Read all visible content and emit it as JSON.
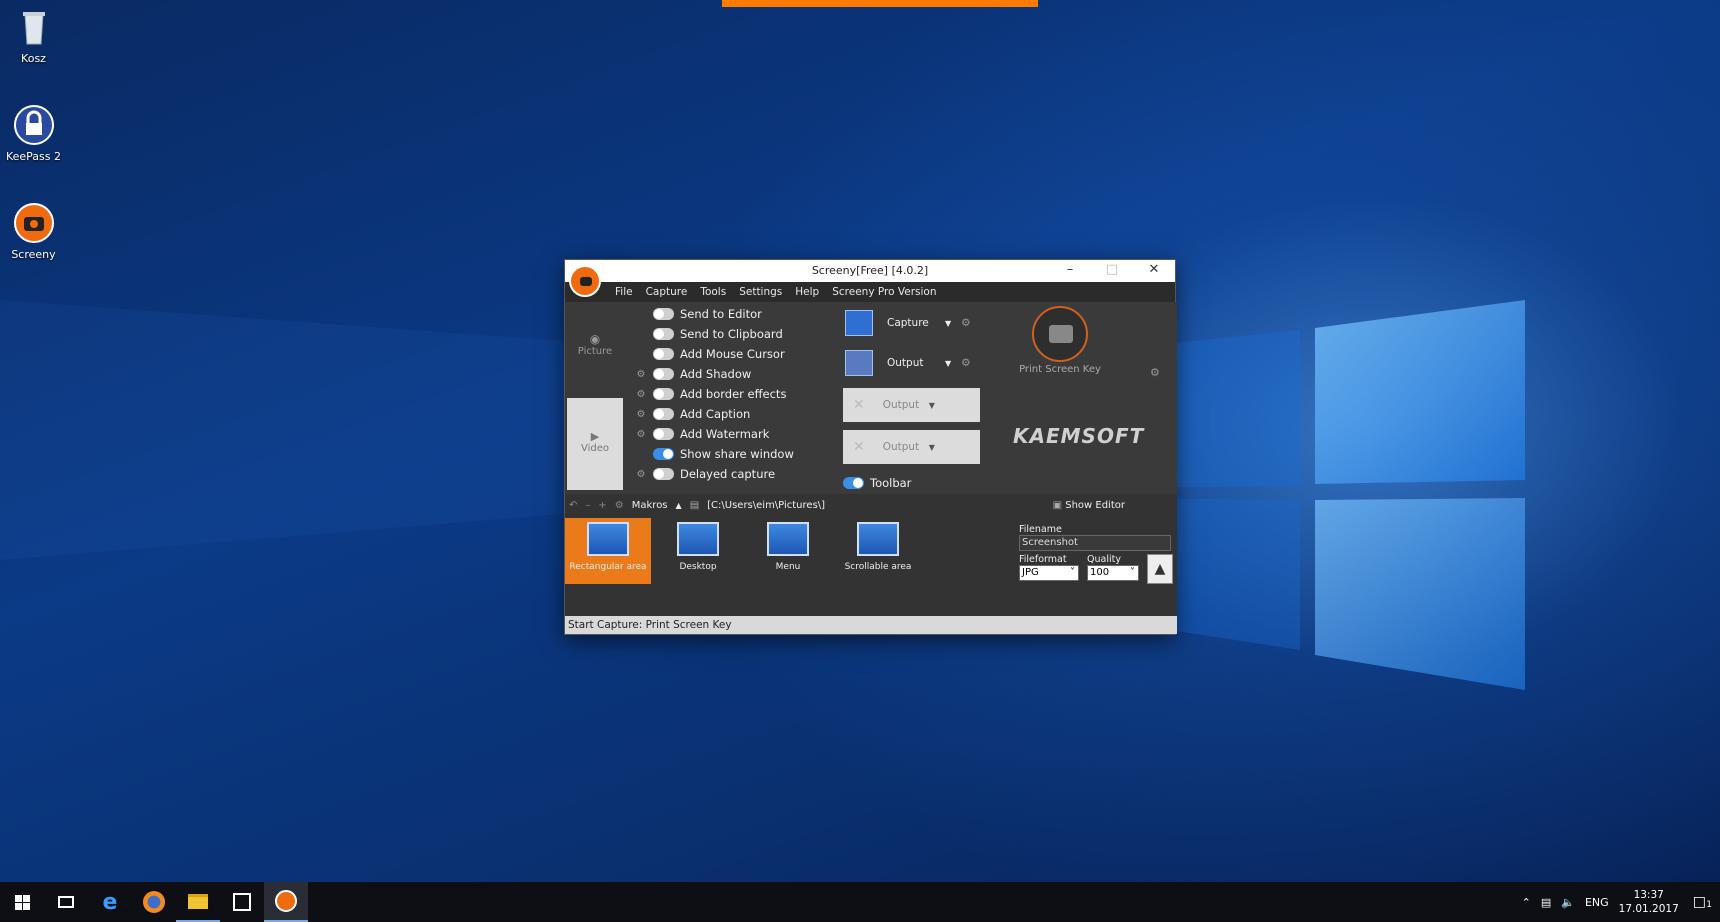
{
  "desktop": {
    "icons": [
      {
        "label": "Kosz"
      },
      {
        "label": "KeePass 2"
      },
      {
        "label": "Screeny"
      }
    ]
  },
  "window": {
    "title": "Screeny[Free] [4.0.2]",
    "menu": [
      "File",
      "Capture",
      "Tools",
      "Settings",
      "Help",
      "Screeny Pro Version"
    ],
    "sidetabs": [
      "Picture",
      "Video"
    ],
    "options": [
      {
        "label": "Send to Editor",
        "on": false
      },
      {
        "label": "Send to Clipboard",
        "on": false
      },
      {
        "label": "Add Mouse Cursor",
        "on": false
      },
      {
        "label": "Add Shadow",
        "on": false
      },
      {
        "label": "Add border effects",
        "on": false
      },
      {
        "label": "Add Caption",
        "on": false
      },
      {
        "label": "Add Watermark",
        "on": false
      },
      {
        "label": "Show share window",
        "on": true
      },
      {
        "label": "Delayed capture",
        "on": false
      }
    ],
    "outputs": {
      "capture": "Capture",
      "output1": "Output",
      "output2": "Output",
      "output3": "Output",
      "toolbar": "Toolbar"
    },
    "hotkey": "Print Screen Key",
    "brand": "KAEMSOFT",
    "pathbar": {
      "makros": "Makros",
      "path": "[C:\\Users\\eim\\Pictures\\]",
      "show_editor": "Show Editor"
    },
    "modes": [
      "Rectangular area",
      "Desktop",
      "Menu",
      "Scrollable area"
    ],
    "filename_label": "Filename",
    "filename_value": "Screenshot",
    "fileformat_label": "Fileformat",
    "fileformat_value": "JPG",
    "quality_label": "Quality",
    "quality_value": "100",
    "status": "Start Capture: Print Screen Key"
  },
  "taskbar": {
    "lang": "ENG",
    "time": "13:37",
    "date": "17.01.2017",
    "notifications": "1"
  }
}
